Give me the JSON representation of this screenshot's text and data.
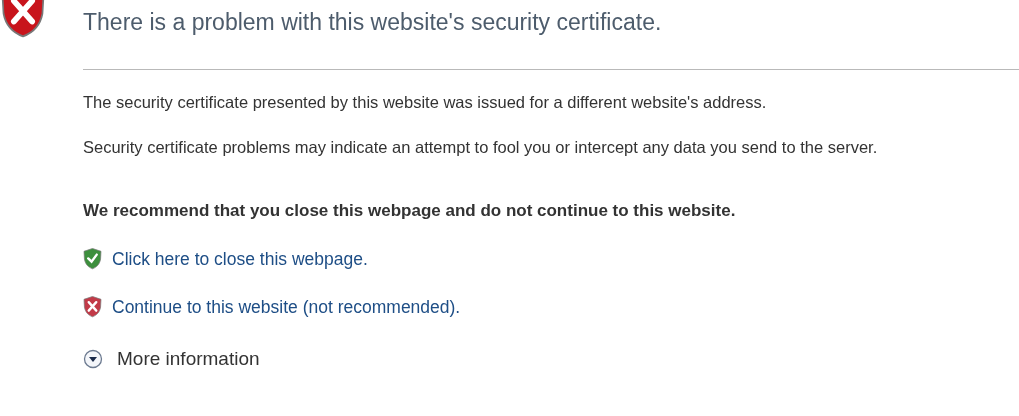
{
  "title": "There is a problem with this website's security certificate.",
  "paragraphs": [
    "The security certificate presented by this website was issued for a different website's address.",
    "Security certificate problems may indicate an attempt to fool you or intercept any data you send to the server."
  ],
  "recommendation": "We recommend that you close this webpage and do not continue to this website.",
  "options": [
    {
      "kind": "safe",
      "label": "Click here to close this webpage."
    },
    {
      "kind": "unsafe",
      "label": "Continue to this website (not recommended)."
    }
  ],
  "more_info": {
    "label": "More information",
    "expanded": false
  }
}
